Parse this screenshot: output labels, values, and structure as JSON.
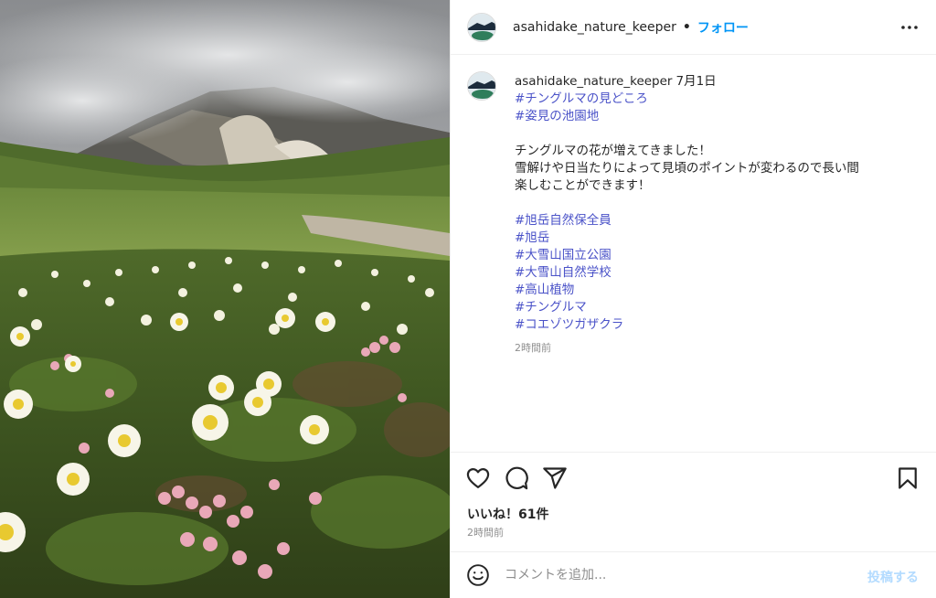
{
  "post": {
    "username": "asahidake_nature_keeper",
    "follow_label": "フォロー",
    "separator": "•",
    "date": "7月1日",
    "caption_hashtags_top": [
      "#チングルマの見どころ",
      "#姿見の池園地"
    ],
    "caption_lines": [
      "チングルマの花が増えてきました！",
      "雪解けや日当たりによって見頃のポイントが変わるので長い間",
      "楽しむことができます！"
    ],
    "caption_hashtags_bottom": [
      "#旭岳自然保全員",
      "#旭岳",
      "#大雪山国立公園",
      "#大雪山自然学校",
      "#高山植物",
      "#チングルマ",
      "#コエゾツガザクラ"
    ],
    "caption_time": "2時間前",
    "likes_label": "いいね！61件",
    "post_time": "2時間前"
  },
  "comment": {
    "placeholder": "コメントを追加...",
    "post_label": "投稿する"
  },
  "icons": {
    "more": "more-horizontal-icon",
    "like": "heart-icon",
    "comment": "comment-bubble-icon",
    "share": "paper-plane-icon",
    "save": "bookmark-icon",
    "emoji": "emoji-smile-icon"
  },
  "colors": {
    "link": "#0095f6",
    "hashtag": "#4a52c8",
    "muted": "#8e8e8e",
    "post_disabled": "#b3dbff"
  }
}
